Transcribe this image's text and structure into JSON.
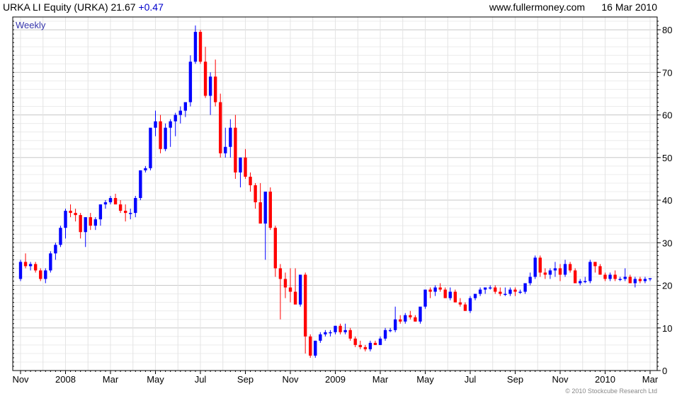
{
  "header": {
    "symbol": "URKA LI Equity (URKA)",
    "price": "21.67",
    "change": "+0.47",
    "source": "www.fullermoney.com",
    "date": "16 Mar 2010"
  },
  "footer": {
    "copyright": "© 2010 Stockcube Research Ltd"
  },
  "colors": {
    "up": "#0000ff",
    "down": "#ff0000",
    "grid": "#dcdcdc",
    "border": "#000000"
  },
  "chart_data": {
    "type": "candlestick",
    "period": "Weekly",
    "ylim": [
      0,
      83
    ],
    "yticks": [
      0,
      10,
      20,
      30,
      40,
      50,
      60,
      70,
      80
    ],
    "grid": true,
    "xticks": [
      {
        "label": "Nov",
        "index": 0
      },
      {
        "label": "2008",
        "index": 9
      },
      {
        "label": "Mar",
        "index": 18
      },
      {
        "label": "May",
        "index": 27
      },
      {
        "label": "Jul",
        "index": 36
      },
      {
        "label": "Sep",
        "index": 45
      },
      {
        "label": "Nov",
        "index": 54
      },
      {
        "label": "2009",
        "index": 63
      },
      {
        "label": "Mar",
        "index": 72
      },
      {
        "label": "May",
        "index": 81
      },
      {
        "label": "Jul",
        "index": 90
      },
      {
        "label": "Sep",
        "index": 99
      },
      {
        "label": "Nov",
        "index": 108
      },
      {
        "label": "2010",
        "index": 117
      },
      {
        "label": "Mar",
        "index": 126
      }
    ],
    "candles": [
      [
        21.5,
        26,
        21,
        25.5
      ],
      [
        25.5,
        27.5,
        24,
        24.5
      ],
      [
        24.5,
        25.5,
        23.5,
        25
      ],
      [
        25,
        25.5,
        23,
        23.5
      ],
      [
        23.5,
        24,
        21,
        21.5
      ],
      [
        21.5,
        24,
        20.5,
        23.5
      ],
      [
        23.5,
        28,
        23,
        27.5
      ],
      [
        27.5,
        30,
        26,
        29.5
      ],
      [
        29.5,
        34,
        29,
        33.5
      ],
      [
        33.5,
        38,
        31,
        37.5
      ],
      [
        37.5,
        39,
        36,
        37
      ],
      [
        37,
        38,
        35,
        36.5
      ],
      [
        36.5,
        37,
        31,
        32.5
      ],
      [
        32.5,
        36,
        29,
        36
      ],
      [
        36,
        37,
        33,
        34
      ],
      [
        34,
        36,
        33,
        35.5
      ],
      [
        35.5,
        39,
        34,
        39
      ],
      [
        39,
        40,
        38,
        39.5
      ],
      [
        39.5,
        41,
        39,
        40.5
      ],
      [
        40.5,
        41.5,
        39.5,
        39
      ],
      [
        39,
        40,
        37,
        37.5
      ],
      [
        37.5,
        39,
        35,
        37
      ],
      [
        37,
        38,
        35.5,
        37
      ],
      [
        37,
        41,
        36,
        40.5
      ],
      [
        40.5,
        47,
        40,
        47
      ],
      [
        47,
        48,
        46.5,
        47.5
      ],
      [
        47.5,
        56,
        47,
        57
      ],
      [
        57,
        61,
        55,
        58.5
      ],
      [
        58.5,
        60,
        51,
        52
      ],
      [
        52,
        58,
        51.5,
        57
      ],
      [
        57,
        59,
        52.5,
        58.5
      ],
      [
        58.5,
        60.5,
        55,
        60
      ],
      [
        60,
        62,
        58,
        61
      ],
      [
        61,
        63,
        59.5,
        63
      ],
      [
        63,
        74,
        62,
        72.5
      ],
      [
        72.5,
        81,
        72,
        79.5
      ],
      [
        79.5,
        80,
        72,
        72.5
      ],
      [
        72.5,
        76,
        64,
        64.5
      ],
      [
        64.5,
        70,
        60,
        69
      ],
      [
        69,
        73,
        62,
        63
      ],
      [
        63,
        65,
        50,
        51
      ],
      [
        51,
        57,
        50,
        52.5
      ],
      [
        52.5,
        59,
        50,
        57
      ],
      [
        57,
        60,
        45,
        46.5
      ],
      [
        46.5,
        50,
        43,
        50
      ],
      [
        50,
        52,
        45,
        45.5
      ],
      [
        45.5,
        46.5,
        42,
        43.5
      ],
      [
        43.5,
        44,
        38,
        39.5
      ],
      [
        39.5,
        44,
        36,
        34.5
      ],
      [
        34.5,
        40,
        26,
        42
      ],
      [
        42,
        43,
        33,
        33.5
      ],
      [
        33.5,
        34,
        22,
        24
      ],
      [
        24,
        25,
        12,
        21.5
      ],
      [
        21.5,
        23,
        17,
        19.5
      ],
      [
        19.5,
        24,
        16,
        18.5
      ],
      [
        18.5,
        24,
        16.5,
        15.5
      ],
      [
        15.5,
        22,
        15,
        22.5
      ],
      [
        22.5,
        23,
        4,
        8
      ],
      [
        8,
        8.5,
        3,
        3.5
      ],
      [
        3.5,
        7,
        3,
        7
      ],
      [
        7,
        9,
        6.5,
        8.5
      ],
      [
        8.5,
        9.5,
        8,
        9
      ],
      [
        9,
        9.5,
        8,
        9
      ],
      [
        9,
        10.5,
        8.5,
        10.5
      ],
      [
        10.5,
        11,
        8.5,
        9
      ],
      [
        9,
        11,
        8.5,
        9.5
      ],
      [
        9.5,
        10,
        7,
        7.5
      ],
      [
        7.5,
        8,
        5.5,
        6
      ],
      [
        6,
        7,
        5,
        5.5
      ],
      [
        5.5,
        6,
        4.5,
        5
      ],
      [
        5,
        7,
        4.5,
        6.5
      ],
      [
        6.5,
        7,
        6,
        6
      ],
      [
        6,
        8,
        6,
        7.5
      ],
      [
        7.5,
        10,
        7,
        9.5
      ],
      [
        9.5,
        10,
        9,
        9.5
      ],
      [
        9.5,
        15,
        9,
        12
      ],
      [
        12,
        13,
        11,
        11.5
      ],
      [
        11.5,
        13.5,
        11,
        13
      ],
      [
        13,
        14,
        12,
        12.5
      ],
      [
        12.5,
        13,
        11.5,
        11.5
      ],
      [
        11.5,
        14,
        11,
        15
      ],
      [
        15,
        19,
        14.5,
        19
      ],
      [
        19,
        19.5,
        17,
        18.5
      ],
      [
        18.5,
        20,
        17.5,
        19.5
      ],
      [
        19.5,
        20.5,
        18.5,
        19
      ],
      [
        19,
        19.5,
        17,
        17
      ],
      [
        17,
        19.5,
        16.5,
        18.5
      ],
      [
        18.5,
        19,
        16,
        16
      ],
      [
        16,
        17,
        15,
        15.5
      ],
      [
        15.5,
        16,
        14,
        14
      ],
      [
        14,
        17.5,
        13.5,
        17
      ],
      [
        17,
        18,
        16.5,
        18
      ],
      [
        18,
        19.5,
        17.5,
        19
      ],
      [
        19,
        19.5,
        18,
        19.5
      ],
      [
        19.5,
        20,
        19,
        19.5
      ],
      [
        19.5,
        20,
        18,
        18.5
      ],
      [
        18.5,
        19.5,
        17.5,
        18
      ],
      [
        18,
        19.5,
        17.5,
        18
      ],
      [
        18,
        19.5,
        17.5,
        19
      ],
      [
        19,
        19.5,
        17.5,
        18.5
      ],
      [
        18.5,
        19,
        18,
        18.5
      ],
      [
        18.5,
        20,
        18,
        20.5
      ],
      [
        20.5,
        23,
        20,
        22
      ],
      [
        22,
        27,
        21.5,
        26.5
      ],
      [
        26.5,
        27,
        22,
        23
      ],
      [
        23,
        24,
        21.5,
        22.5
      ],
      [
        22.5,
        24,
        21.5,
        23.5
      ],
      [
        23.5,
        25.5,
        22,
        24
      ],
      [
        24,
        25,
        21,
        22.5
      ],
      [
        22.5,
        26,
        22,
        25
      ],
      [
        25,
        25.5,
        23,
        23.5
      ],
      [
        23.5,
        24,
        20.5,
        20.5
      ],
      [
        20.5,
        21.5,
        20,
        21
      ],
      [
        21,
        22,
        20.5,
        21
      ],
      [
        21,
        26,
        20.5,
        25.5
      ],
      [
        25.5,
        25.5,
        23,
        24.5
      ],
      [
        24.5,
        25,
        22.5,
        22.5
      ],
      [
        22.5,
        23,
        21,
        21.5
      ],
      [
        21.5,
        23,
        21,
        22.5
      ],
      [
        22.5,
        23.5,
        21,
        21.5
      ],
      [
        21.5,
        22,
        21,
        21.5
      ],
      [
        21.5,
        24,
        21,
        22
      ],
      [
        22,
        22.5,
        20.5,
        20.5
      ],
      [
        20.5,
        22,
        19.5,
        21.5
      ],
      [
        21.5,
        22,
        20.5,
        21
      ],
      [
        21,
        22,
        20.5,
        21.5
      ],
      [
        21.5,
        21.67,
        21,
        21.67
      ]
    ]
  }
}
